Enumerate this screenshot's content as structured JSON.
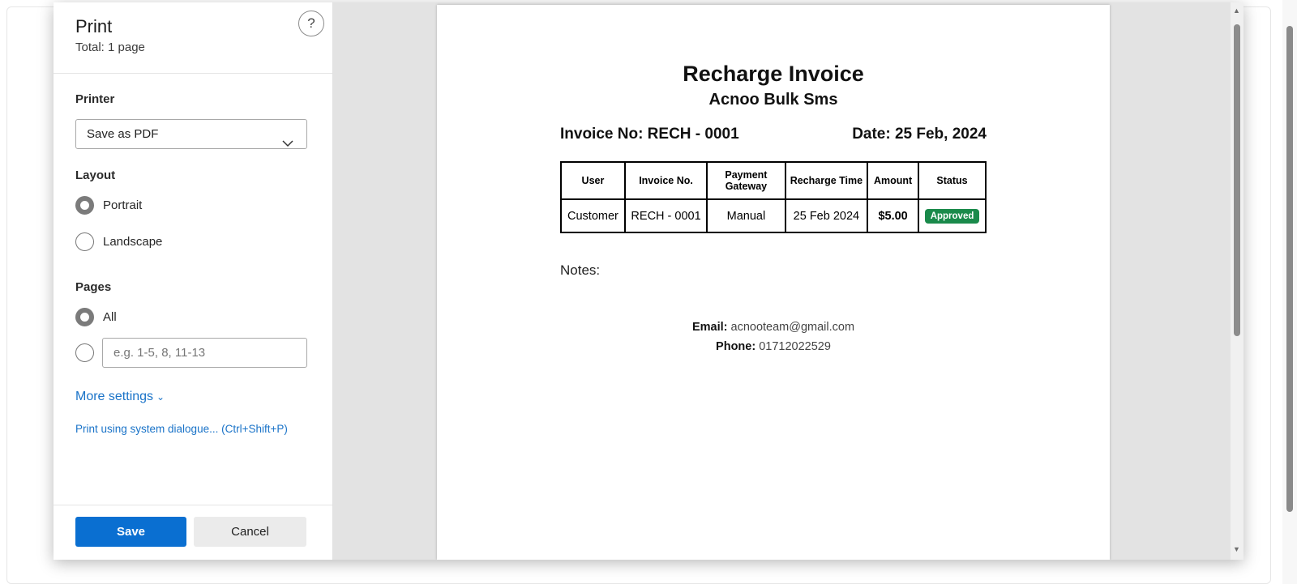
{
  "print_panel": {
    "title": "Print",
    "total": "Total: 1 page",
    "help_label": "?",
    "printer_label": "Printer",
    "printer_value": "Save as PDF",
    "layout_label": "Layout",
    "layout_options": [
      "Portrait",
      "Landscape"
    ],
    "layout_selected": "Portrait",
    "pages_label": "Pages",
    "pages_all_label": "All",
    "pages_range_placeholder": "e.g. 1-5, 8, 11-13",
    "more_settings": "More settings",
    "system_dialogue": "Print using system dialogue... (Ctrl+Shift+P)",
    "save_button": "Save",
    "cancel_button": "Cancel"
  },
  "invoice": {
    "title": "Recharge Invoice",
    "company": "Acnoo Bulk Sms",
    "invoice_no": "Invoice No: RECH - 0001",
    "date": "Date: 25 Feb, 2024",
    "table_headers": [
      "User",
      "Invoice No.",
      "Payment Gateway",
      "Recharge Time",
      "Amount",
      "Status"
    ],
    "row": {
      "user": "Customer",
      "invoice_no": "RECH - 0001",
      "gateway": "Manual",
      "time": "25 Feb 2024",
      "amount": "$5.00",
      "status": "Approved"
    },
    "notes_label": "Notes:",
    "email_label": "Email:",
    "email_value": "acnooteam@gmail.com",
    "phone_label": "Phone:",
    "phone_value": "01712022529"
  },
  "colors": {
    "accent": "#0a6fd1",
    "link": "#1a73c8",
    "status_badge": "#1a8a4b"
  }
}
